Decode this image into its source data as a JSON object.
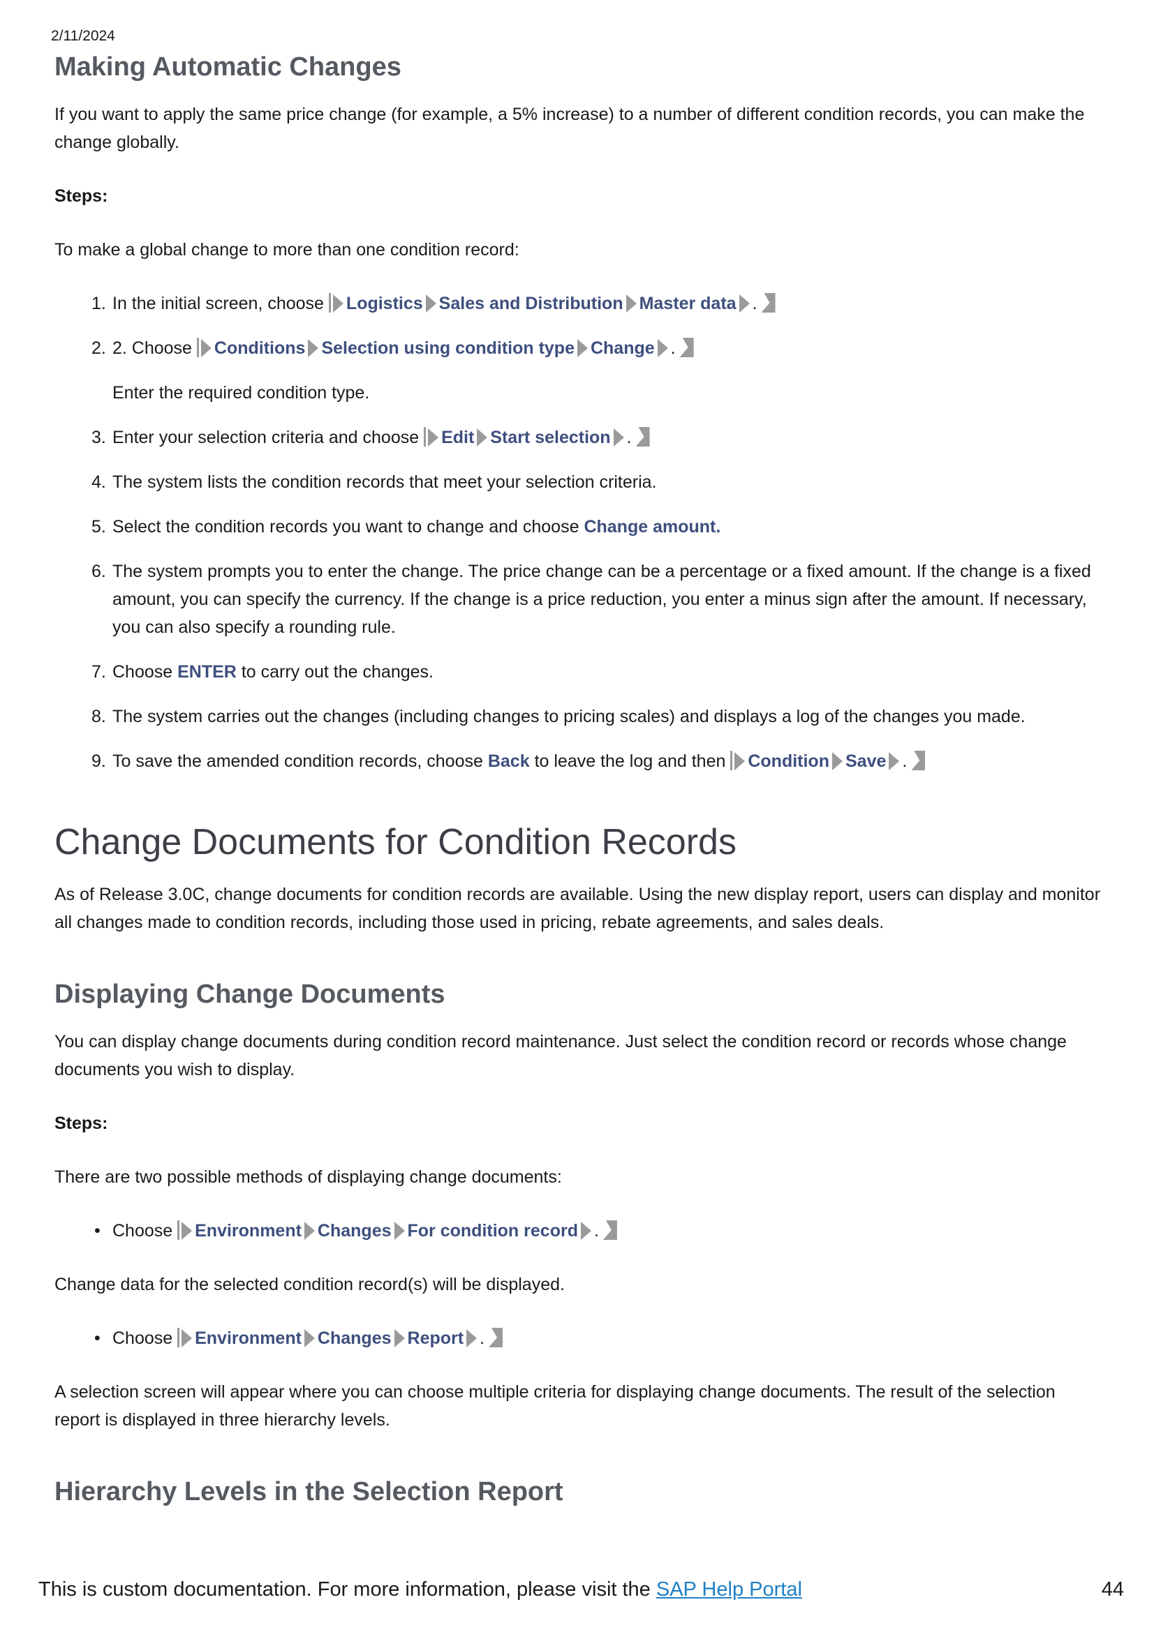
{
  "header": {
    "date": "2/11/2024"
  },
  "section1": {
    "title": "Making Automatic Changes",
    "intro": "If you want to apply the same price change (for example, a 5% increase) to a number of different condition records, you can make the change globally.",
    "steps_label": "Steps:",
    "lead": "To make a global change to more than one condition record:",
    "items": {
      "i1": {
        "num": "1.",
        "pre": "In the initial screen, choose",
        "m1": "Logistics",
        "m2": "Sales and Distribution",
        "m3": "Master data",
        "post": "."
      },
      "i2": {
        "num": "2.",
        "pre": "2. Choose",
        "m1": "Conditions",
        "m2": "Selection using condition type",
        "m3": "Change",
        "post": ".",
        "note": "Enter the required condition type."
      },
      "i3": {
        "num": "3.",
        "pre": "Enter your selection criteria and choose",
        "m1": "Edit",
        "m2": "Start selection",
        "post": "."
      },
      "i4": {
        "num": "4.",
        "text": "The system lists the condition records that meet your selection criteria."
      },
      "i5": {
        "num": "5.",
        "pre": "Select the condition records you want to change and choose",
        "hl": "Change amount."
      },
      "i6": {
        "num": "6.",
        "text": "The system prompts you to enter the change. The price change can be a percentage or a fixed amount. If the change is a fixed amount, you can specify the currency. If the change is a price reduction, you enter a minus sign after the amount. If necessary, you can also specify a rounding rule."
      },
      "i7": {
        "num": "7.",
        "pre": "Choose",
        "hl": "ENTER",
        "post": "to carry out the changes."
      },
      "i8": {
        "num": "8.",
        "text": "The system carries out the changes (including changes to pricing scales) and displays a log of the changes you made."
      },
      "i9": {
        "num": "9.",
        "pre": "To save the amended condition records, choose",
        "hl": "Back",
        "mid": "to leave the log and then",
        "m1": "Condition",
        "m2": "Save",
        "post": "."
      }
    }
  },
  "section2": {
    "title": "Change Documents for Condition Records",
    "intro": "As of Release 3.0C, change documents for condition records are available. Using the new display report, users can display and monitor all changes made to condition records, including those used in pricing, rebate agreements, and sales deals."
  },
  "section3": {
    "title": "Displaying Change Documents",
    "intro": "You can display change documents during condition record maintenance. Just select the condition record or records whose change documents you wish to display.",
    "steps_label": "Steps:",
    "lead": "There are two possible methods of displaying change documents:",
    "b1": {
      "pre": "Choose",
      "m1": "Environment",
      "m2": "Changes",
      "m3": "For condition record",
      "post": "."
    },
    "after1": "Change data for the selected condition record(s) will be displayed.",
    "b2": {
      "pre": "Choose",
      "m1": "Environment",
      "m2": "Changes",
      "m3": "Report",
      "post": "."
    },
    "after2": "A selection screen will appear where you can choose multiple criteria for displaying change documents. The result of the selection report is displayed in three hierarchy levels."
  },
  "section4": {
    "title": "Hierarchy Levels in the Selection Report"
  },
  "footer": {
    "text": "This is custom documentation. For more information, please visit the",
    "link": "SAP Help Portal",
    "page": "44"
  }
}
